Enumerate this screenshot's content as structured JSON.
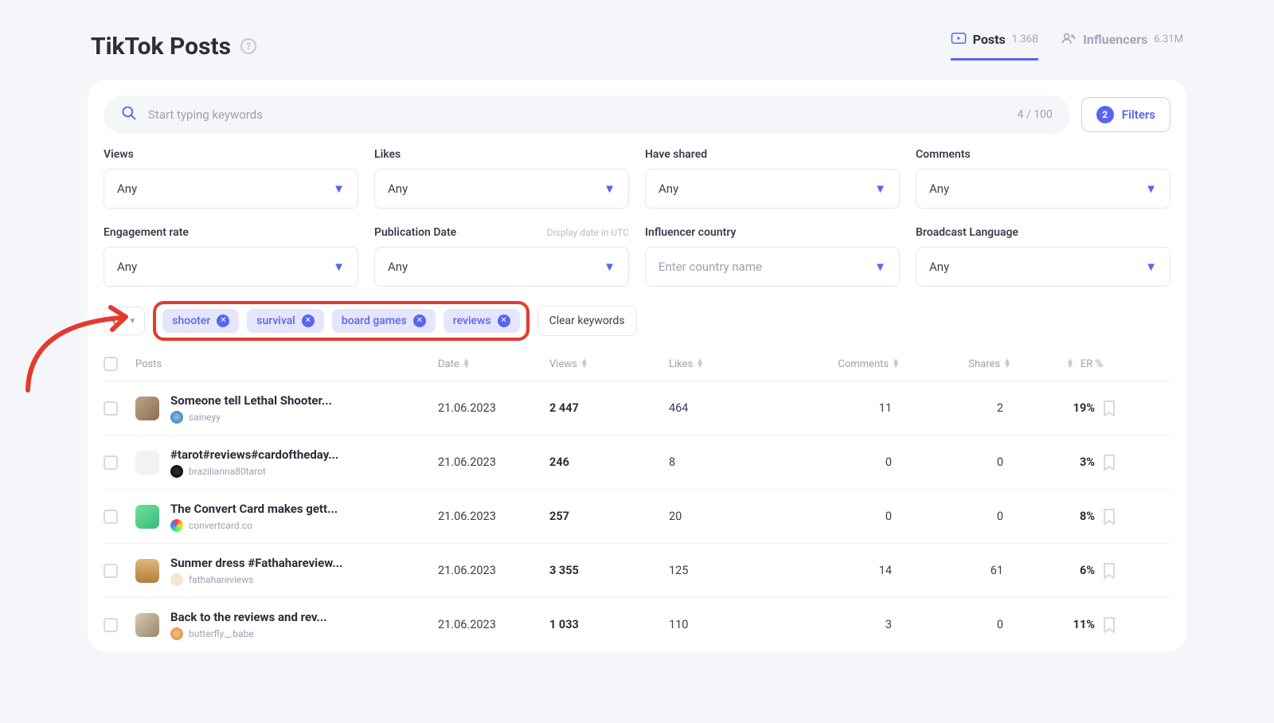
{
  "header": {
    "title": "TikTok Posts",
    "tabs": [
      {
        "label": "Posts",
        "count": "1.36B",
        "active": true
      },
      {
        "label": "Influencers",
        "count": "6.31M",
        "active": false
      }
    ]
  },
  "search": {
    "placeholder": "Start typing keywords",
    "counter": "4 / 100",
    "filters_label": "Filters",
    "filters_count": "2"
  },
  "filters": [
    {
      "label": "Views",
      "value": "Any"
    },
    {
      "label": "Likes",
      "value": "Any"
    },
    {
      "label": "Have shared",
      "value": "Any"
    },
    {
      "label": "Comments",
      "value": "Any"
    },
    {
      "label": "Engagement rate",
      "value": "Any"
    },
    {
      "label": "Publication Date",
      "hint": "Display date in UTC",
      "value": "Any"
    },
    {
      "label": "Influencer country",
      "value": "Enter country name",
      "placeholder": true
    },
    {
      "label": "Broadcast Language",
      "value": "Any"
    }
  ],
  "chip_row": {
    "logic": "Or",
    "chips": [
      "shooter",
      "survival",
      "board games",
      "reviews"
    ],
    "clear_label": "Clear keywords"
  },
  "columns": [
    "Posts",
    "Date",
    "Views",
    "Likes",
    "Comments",
    "Shares",
    "ER %"
  ],
  "rows": [
    {
      "title": "Someone tell Lethal Shooter...",
      "author": "saineyy",
      "date": "21.06.2023",
      "views": "2 447",
      "likes": "464",
      "comments": "11",
      "shares": "2",
      "er": "19%",
      "thumb": "img1",
      "avatar": "a1"
    },
    {
      "title": "#tarot#reviews#cardoftheday...",
      "author": "brazilianna80tarot",
      "date": "21.06.2023",
      "views": "246",
      "likes": "8",
      "comments": "0",
      "shares": "0",
      "er": "3%",
      "thumb": "img2",
      "avatar": "a2"
    },
    {
      "title": "The Convert Card makes gett...",
      "author": "convertcard.co",
      "date": "21.06.2023",
      "views": "257",
      "likes": "20",
      "comments": "0",
      "shares": "0",
      "er": "8%",
      "thumb": "img3",
      "avatar": "a3"
    },
    {
      "title": "Sunmer dress #Fathahareview...",
      "author": "fathahareviews",
      "date": "21.06.2023",
      "views": "3 355",
      "likes": "125",
      "comments": "14",
      "shares": "61",
      "er": "6%",
      "thumb": "img4",
      "avatar": "a4"
    },
    {
      "title": "Back to the reviews and rev...",
      "author": "butterfly._.babe",
      "date": "21.06.2023",
      "views": "1 033",
      "likes": "110",
      "comments": "3",
      "shares": "0",
      "er": "11%",
      "thumb": "img5",
      "avatar": "a5"
    }
  ]
}
